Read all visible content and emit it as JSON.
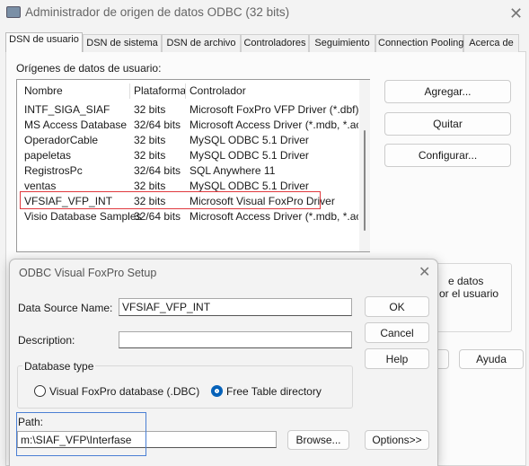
{
  "window": {
    "title": "Administrador de origen de datos ODBC (32 bits)",
    "close_icon": "close-icon"
  },
  "tabs": [
    "DSN de usuario",
    "DSN de sistema",
    "DSN de archivo",
    "Controladores",
    "Seguimiento",
    "Connection Pooling",
    "Acerca de"
  ],
  "panel": {
    "list_label": "Orígenes de datos de usuario:",
    "columns": [
      "Nombre",
      "Plataforma",
      "Controlador"
    ],
    "rows": [
      [
        "INTF_SIGA_SIAF",
        "32 bits",
        "Microsoft FoxPro VFP Driver (*.dbf)"
      ],
      [
        "MS Access Database",
        "32/64 bits",
        "Microsoft Access Driver (*.mdb, *.accdb)"
      ],
      [
        "OperadorCable",
        "32 bits",
        "MySQL ODBC 5.1 Driver"
      ],
      [
        "papeletas",
        "32 bits",
        "MySQL ODBC 5.1 Driver"
      ],
      [
        "RegistrosPc",
        "32/64 bits",
        "SQL Anywhere 11"
      ],
      [
        "ventas",
        "32 bits",
        "MySQL ODBC 5.1 Driver"
      ],
      [
        "VFSIAF_VFP_INT",
        "32 bits",
        "Microsoft Visual FoxPro Driver"
      ],
      [
        "Visio Database Samples",
        "32/64 bits",
        "Microsoft Access Driver (*.mdb, *.accdb)"
      ]
    ],
    "highlighted_row": "VFSIAF_VFP_INT",
    "buttons": {
      "add": "Agregar...",
      "remove": "Quitar",
      "configure": "Configurar...",
      "help": "Ayuda"
    },
    "info_partial": [
      "e datos",
      "or el usuario"
    ]
  },
  "dialog": {
    "title": "ODBC Visual FoxPro Setup",
    "dsn_label": "Data Source Name:",
    "dsn_value": "VFSIAF_VFP_INT",
    "desc_label": "Description:",
    "desc_value": "",
    "ok": "OK",
    "cancel": "Cancel",
    "help": "Help",
    "db_type_label": "Database type",
    "radio_dbc": "Visual FoxPro database (.DBC)",
    "radio_free": "Free Table directory",
    "selected": "Free Table directory",
    "path_label": "Path:",
    "path_value": "m:\\SIAF_VFP\\Interfase",
    "browse": "Browse...",
    "options": "Options>>"
  },
  "colors": {
    "accent": "#005fb8",
    "row_highlight": "#e0393e",
    "path_highlight": "#4a7fd4"
  }
}
